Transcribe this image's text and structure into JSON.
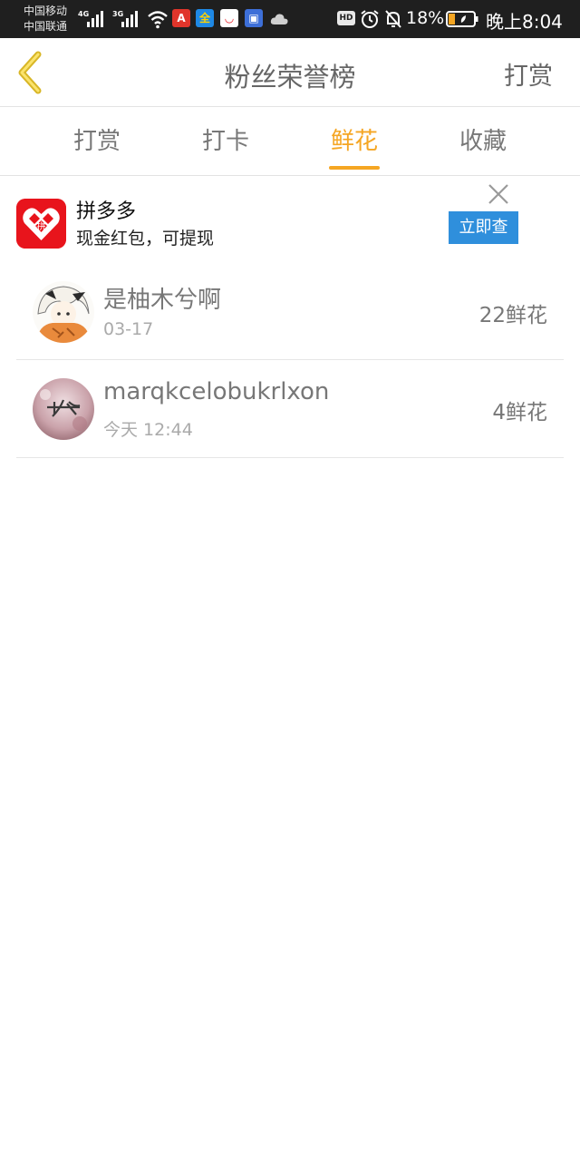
{
  "status_bar": {
    "carrier_1": "中国移动",
    "carrier_2": "中国联通",
    "net_1": "4G",
    "net_2": "3G",
    "hd": "HD",
    "battery_percent": "18%",
    "time": "晚上8:04",
    "app_icons": [
      "adobe-icon",
      "quanmin-icon",
      "jd-icon",
      "calendar-icon",
      "cloud-icon"
    ]
  },
  "header": {
    "title": "粉丝荣誉榜",
    "right_action": "打赏"
  },
  "tabs": [
    {
      "label": "打赏",
      "active": false
    },
    {
      "label": "打卡",
      "active": false
    },
    {
      "label": "鲜花",
      "active": true
    },
    {
      "label": "收藏",
      "active": false
    }
  ],
  "ad": {
    "logo_text": "拼",
    "title": "拼多多",
    "description": "现金红包，可提现",
    "button": "立即查"
  },
  "fans": [
    {
      "name": "是柚木兮啊",
      "date": "03-17",
      "count": "22鲜花"
    },
    {
      "name": "marqkcelobukrlxon",
      "date": "今天 12:44",
      "count": "4鲜花"
    }
  ],
  "colors": {
    "accent": "#f5a623",
    "status_bar": "#1f1f1f",
    "ad_button": "#2f8fdc",
    "ad_logo": "#e8141c"
  }
}
